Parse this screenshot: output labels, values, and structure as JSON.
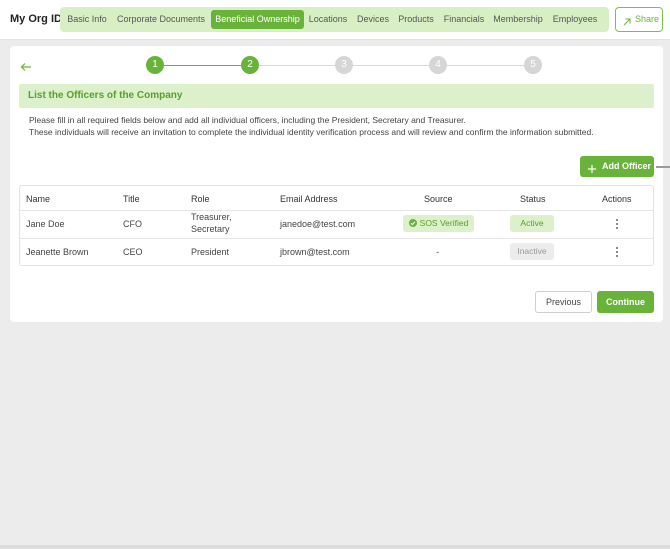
{
  "header": {
    "brand": "My Org ID",
    "tabs": [
      {
        "label": "Basic Info",
        "active": false
      },
      {
        "label": "Corporate Documents",
        "active": false
      },
      {
        "label": "Beneficial Ownership",
        "active": true
      },
      {
        "label": "Locations",
        "active": false
      },
      {
        "label": "Devices",
        "active": false
      },
      {
        "label": "Products",
        "active": false
      },
      {
        "label": "Financials",
        "active": false
      },
      {
        "label": "Membership",
        "active": false
      },
      {
        "label": "Employees",
        "active": false
      }
    ],
    "share_label": "Share",
    "share_icon": "external-arrow-icon"
  },
  "stepper": {
    "steps": [
      "1",
      "2",
      "3",
      "4",
      "5"
    ],
    "completed_through": 2
  },
  "section": {
    "title": "List the Officers of the Company",
    "intro_lines": [
      "Please fill in all required fields below and add all individual officers, including the President, Secretary and Treasurer.",
      "These individuals will receive an invitation to complete the individual identity verification process and will review and confirm the information submitted."
    ]
  },
  "add_button": {
    "label": "Add Officer",
    "icon": "plus-icon"
  },
  "table": {
    "columns": [
      "Name",
      "Title",
      "Role",
      "Email Address",
      "Source",
      "Status",
      "Actions"
    ],
    "rows": [
      {
        "name": "Jane Doe",
        "title": "CFO",
        "role_lines": [
          "Treasurer,",
          "Secretary"
        ],
        "email": "janedoe@test.com",
        "source": "SOS Verified",
        "status": "Active"
      },
      {
        "name": "Jeanette Brown",
        "title": "CEO",
        "role_lines": [
          "President"
        ],
        "email": "jbrown@test.com",
        "source": "-",
        "status": "Inactive"
      }
    ]
  },
  "footer": {
    "previous_label": "Previous",
    "continue_label": "Continue"
  },
  "colors": {
    "accent": "#6ab33a",
    "accent_light": "#dcf0cb",
    "nav_bg": "#d8efc6",
    "page_bg": "#ececec"
  }
}
